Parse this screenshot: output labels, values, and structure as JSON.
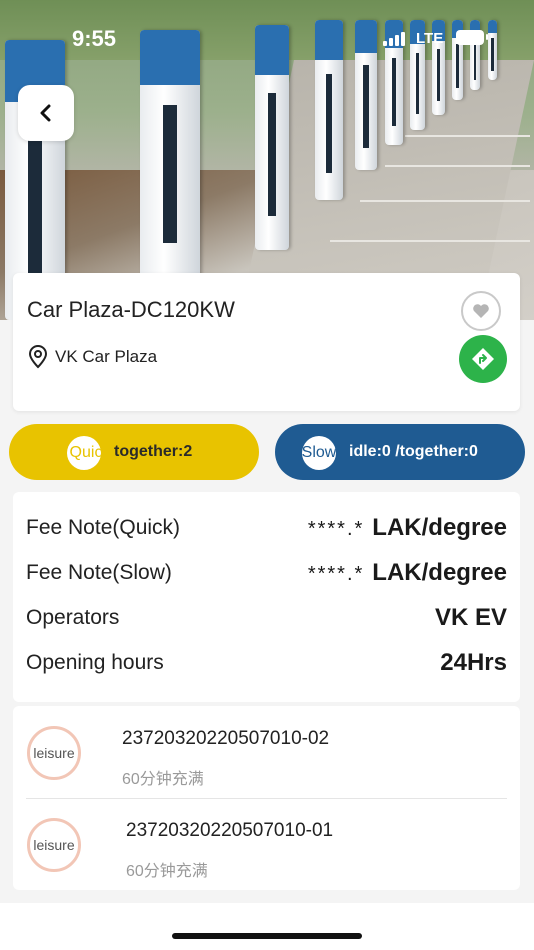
{
  "status_bar": {
    "time": "9:55",
    "network": "LTE",
    "signal_icon": "signal-bars-icon",
    "battery_icon": "battery-icon"
  },
  "hero": {
    "image": "ev-charging-stations-photo"
  },
  "back_icon": "chevron-left-icon",
  "station": {
    "name": "Car Plaza-DC120KW",
    "location": "VK Car Plaza",
    "location_icon": "map-pin-icon",
    "favorite_icon": "heart-icon",
    "navigate_icon": "navigation-arrow-icon"
  },
  "chargers_summary": {
    "quick": {
      "circle_label": "Quic",
      "text": "together:2",
      "color": "#e8c300"
    },
    "slow": {
      "circle_label": "Slow",
      "text": "idle:0 /together:0",
      "color": "#1f5b92"
    }
  },
  "fees": [
    {
      "label": "Fee Note(Quick)",
      "masked": "****.*",
      "value": "LAK/degree"
    },
    {
      "label": "Fee Note(Slow)",
      "masked": "****.*",
      "value": "LAK/degree"
    },
    {
      "label": "Operators",
      "masked": "",
      "value": "VK EV"
    },
    {
      "label": "Opening hours",
      "masked": "",
      "value": "24Hrs"
    }
  ],
  "chargers": [
    {
      "status": "leisure",
      "id": "23720320220507010-02",
      "note": "60分钟充满"
    },
    {
      "status": "leisure",
      "id": "23720320220507010-01",
      "note": "60分钟充满"
    }
  ],
  "colors": {
    "quick": "#e8c300",
    "slow": "#1f5b92",
    "navigate": "#2db34a",
    "status_ring": "#f2c6b6"
  }
}
